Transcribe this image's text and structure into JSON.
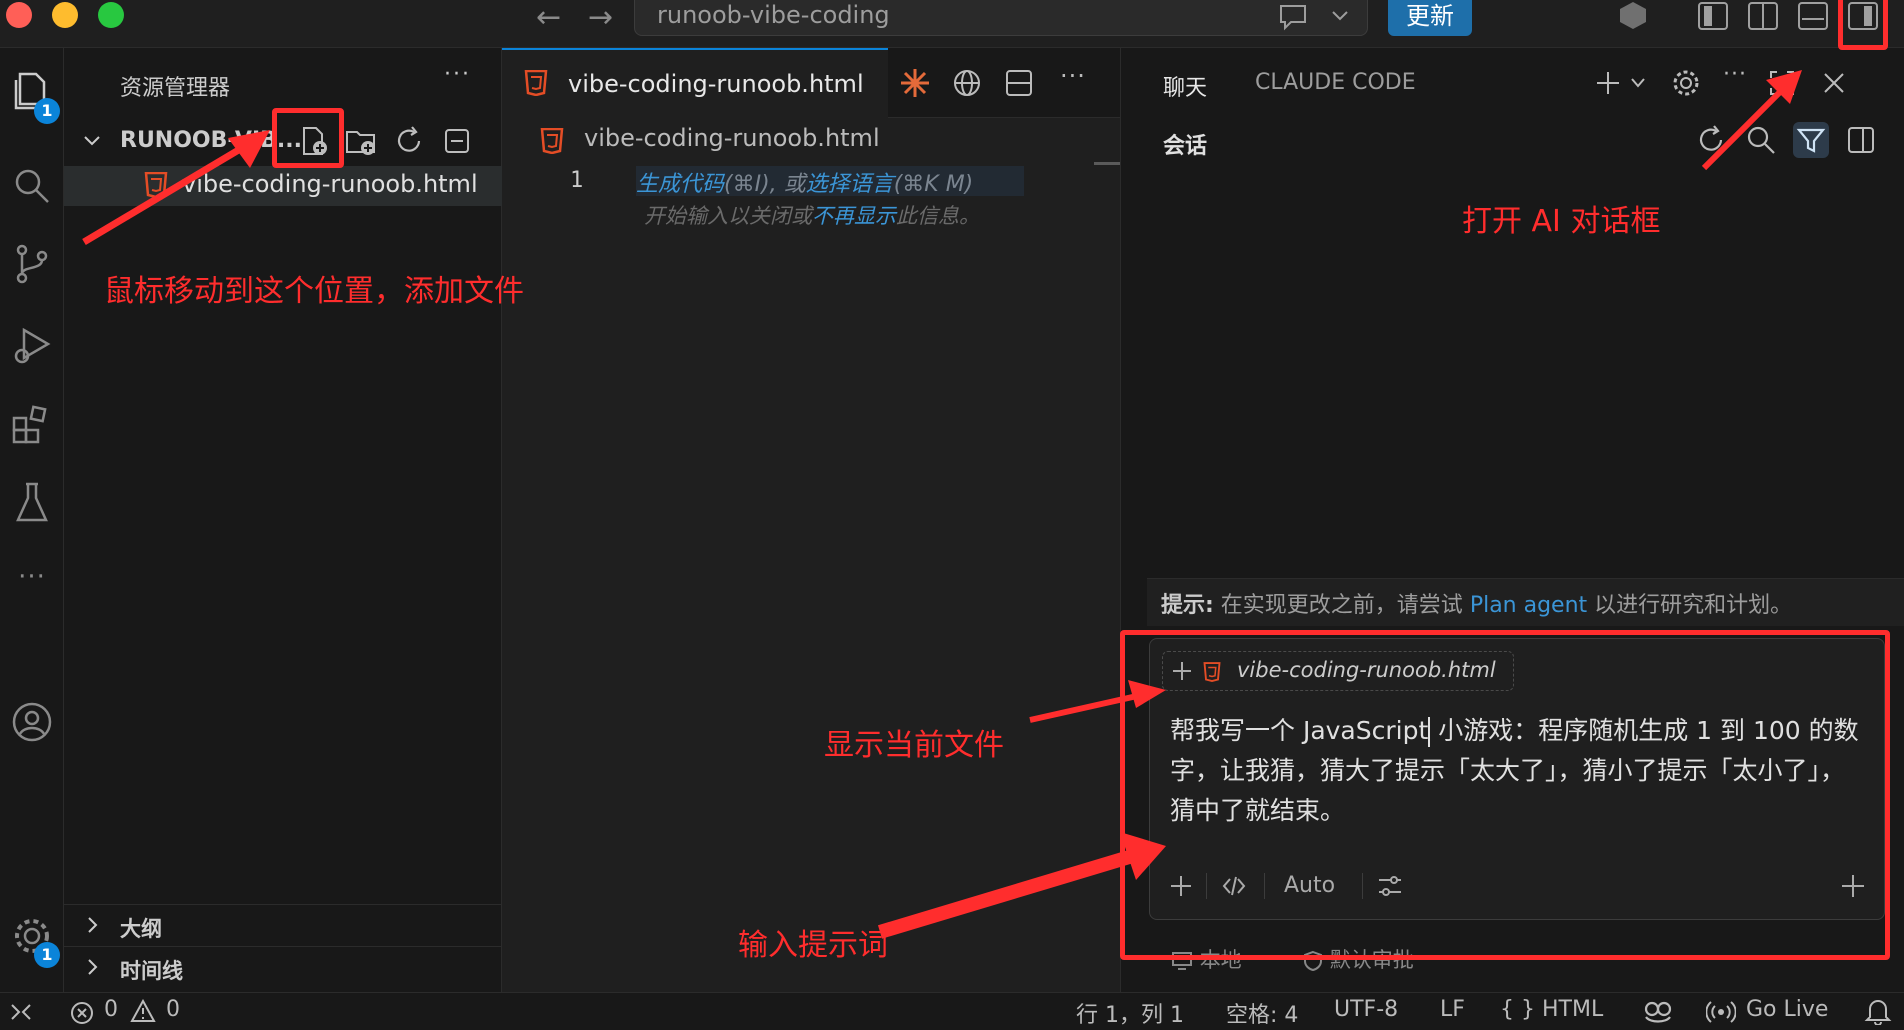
{
  "titlebar": {
    "search_text": "runoob-vibe-coding",
    "update_label": "更新",
    "back_glyph": "←",
    "forward_glyph": "→"
  },
  "activity": {
    "explorer_badge": "1",
    "settings_badge": "1",
    "more_glyph": "···"
  },
  "sidebar": {
    "title": "资源管理器",
    "more": "···",
    "folder_name": "RUNOOB-VIB...",
    "file_name": "vibe-coding-runoob.html",
    "outline_label": "大纲",
    "timeline_label": "时间线"
  },
  "editor": {
    "tab_name": "vibe-coding-runoob.html",
    "breadcrumb": "vibe-coding-runoob.html",
    "line_number": "1",
    "hint_generate": "生成代码",
    "hint_generate_key": "(⌘I), 或",
    "hint_language": "选择语言",
    "hint_language_key": "(⌘K M)",
    "hint_line2_a": "开始输入以关闭或",
    "hint_line2_link": "不再显示",
    "hint_line2_b": "此信息。"
  },
  "chat": {
    "tab_chat": "聊天",
    "tab_claude": "CLAUDE CODE",
    "session_label": "会话",
    "tip_prefix": "提示:",
    "tip_a": " 在实现更改之前，请尝试 ",
    "tip_link": "Plan agent",
    "tip_b": " 以进行研究和计划。",
    "attachment_name": "vibe-coding-runoob.html",
    "prompt_a": "帮我写一个 JavaScript",
    "prompt_b": " 小游戏：程序随机生成 1 到 100 的数字，让我猜，猜大了提示「太大了」，猜小了提示「太小了」，猜中了就结束。",
    "mode_label": "Auto",
    "below_a": "本地",
    "below_b": "默认审批"
  },
  "status": {
    "errors": "0",
    "warnings": "0",
    "position": "行 1，列 1",
    "spaces": "空格: 4",
    "encoding": "UTF-8",
    "eol": "LF",
    "language": "{ } HTML",
    "golive": "Go Live"
  },
  "annotations": {
    "add_file": "鼠标移动到这个位置，添加文件",
    "open_ai": "打开 AI 对话框",
    "show_file": "显示当前文件",
    "enter_prompt": "输入提示词",
    "color": "#ff2d2d"
  },
  "colors": {
    "accent": "#0b84d9",
    "html_icon": "#e44d26",
    "link": "#3b95d6"
  }
}
